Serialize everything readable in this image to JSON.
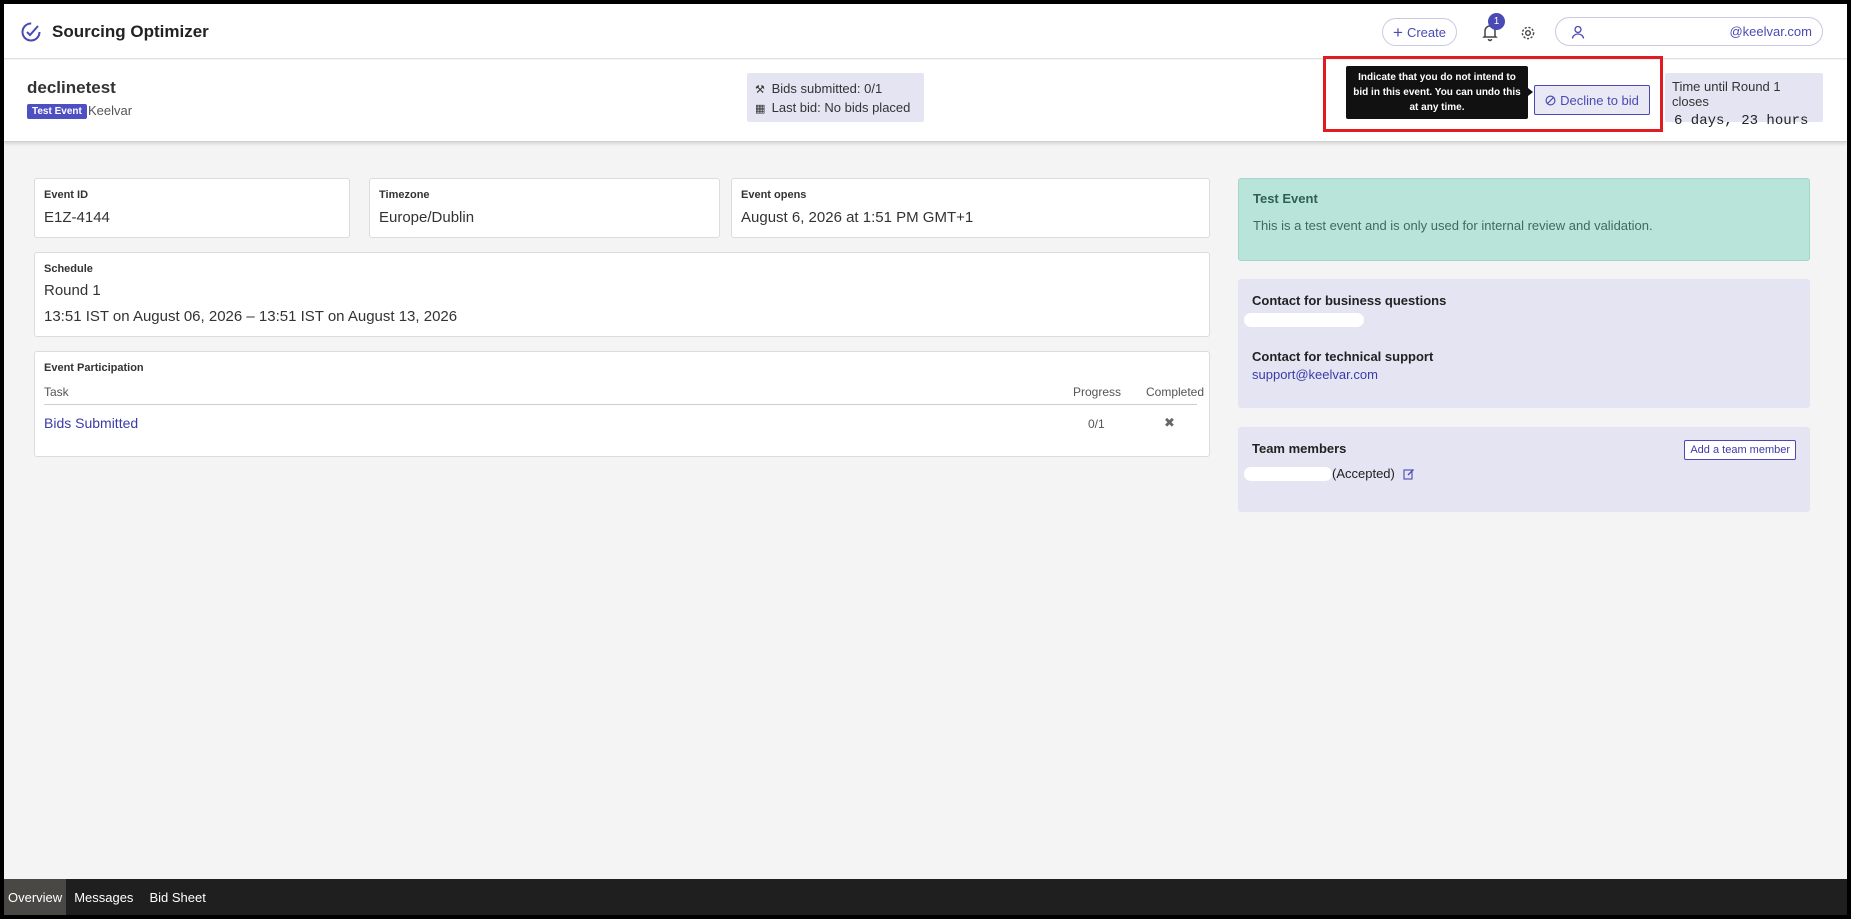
{
  "app": {
    "title": "Sourcing Optimizer"
  },
  "nav": {
    "create_label": "Create",
    "notification_count": "1",
    "user_email": "@keelvar.com"
  },
  "event": {
    "name": "declinetest",
    "badge": "Test Event",
    "org": "Keelvar",
    "bids_submitted": "Bids submitted: 0/1",
    "last_bid": "Last bid: No bids placed",
    "tooltip": "Indicate that you do not intend to bid in this event. You can undo this at any time.",
    "decline_label": "Decline to bid",
    "time_label": "Time until Round 1 closes",
    "time_value": "6 days, 23 hours"
  },
  "details": {
    "event_id_label": "Event ID",
    "event_id": "E1Z-4144",
    "timezone_label": "Timezone",
    "timezone": "Europe/Dublin",
    "opens_label": "Event opens",
    "opens": "August 6, 2026 at 1:51 PM GMT+1"
  },
  "schedule": {
    "label": "Schedule",
    "round": "Round 1",
    "range": "13:51 IST on August 06, 2026 – 13:51 IST on August 13, 2026"
  },
  "participation": {
    "label": "Event Participation",
    "col_task": "Task",
    "col_progress": "Progress",
    "col_completed": "Completed",
    "rows": [
      {
        "task": "Bids Submitted",
        "progress": "0/1",
        "completed": "✖"
      }
    ]
  },
  "test_notice": {
    "title": "Test Event",
    "desc": "This is a test event and is only used for internal review and validation."
  },
  "contacts": {
    "business_label": "Contact for business questions",
    "tech_label": "Contact for technical support",
    "tech_email": "support@keelvar.com"
  },
  "team": {
    "title": "Team members",
    "add_label": "Add a team member",
    "member_status": "(Accepted)"
  },
  "bottom_tabs": [
    {
      "label": "Overview"
    },
    {
      "label": "Messages"
    },
    {
      "label": "Bid Sheet"
    }
  ],
  "colors": {
    "accent": "#4a4ab5",
    "highlight": "#e01b22",
    "test_bg": "#b9e4da",
    "panel_bg": "#e4e4f3"
  }
}
